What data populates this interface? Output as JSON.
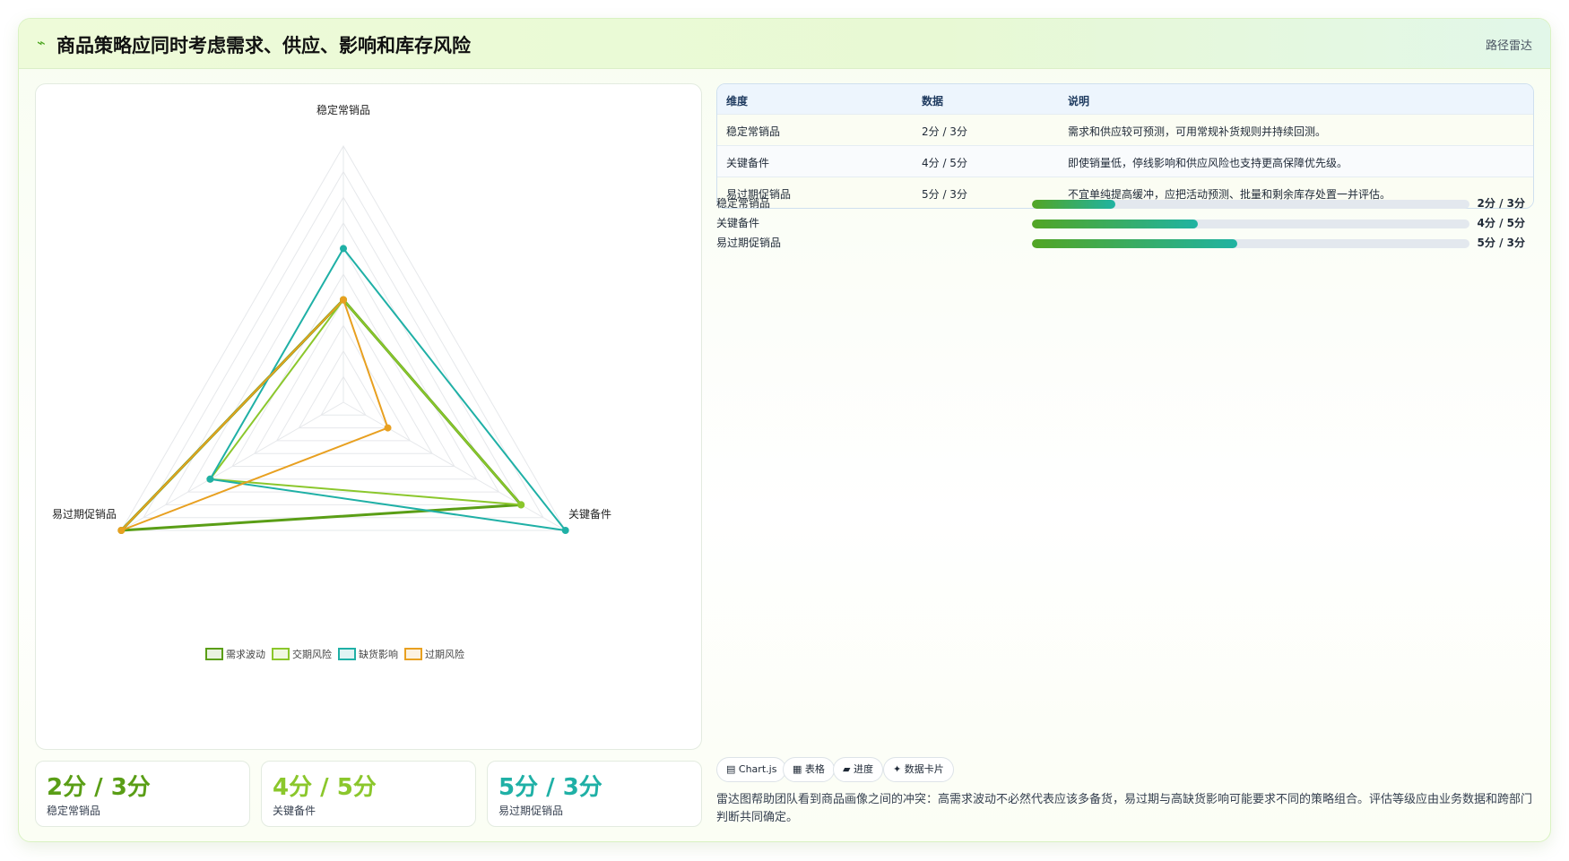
{
  "header": {
    "icon": "bolt-icon",
    "title": "商品策略应同时考虑需求、供应、影响和库存风险",
    "tag": "路径雷达"
  },
  "chart_data": {
    "type": "radar",
    "axes": [
      "稳定常销品",
      "关键备件",
      "易过期促销品"
    ],
    "max": 5,
    "series": [
      {
        "name": "需求波动",
        "values": [
          2,
          4,
          5
        ],
        "color": "#5a9e16"
      },
      {
        "name": "交期风险",
        "values": [
          2,
          4,
          3
        ],
        "color": "#8bc72c"
      },
      {
        "name": "缺货影响",
        "values": [
          3,
          5,
          3
        ],
        "color": "#1fb0a6"
      },
      {
        "name": "过期风险",
        "values": [
          2,
          1,
          5
        ],
        "color": "#e8a020"
      }
    ],
    "grid_levels": 10,
    "legend_position": "bottom"
  },
  "stats": [
    {
      "value": "2分 / 3分",
      "label": "稳定常销品",
      "color": "#5a9e16"
    },
    {
      "value": "4分 / 5分",
      "label": "关键备件",
      "color": "#8bc72c"
    },
    {
      "value": "5分 / 3分",
      "label": "易过期促销品",
      "color": "#1fb0a6"
    }
  ],
  "table": {
    "headers": [
      "维度",
      "数据",
      "说明"
    ],
    "rows": [
      [
        "稳定常销品",
        "2分 / 3分",
        "需求和供应较可预测，可用常规补货规则并持续回测。"
      ],
      [
        "关键备件",
        "4分 / 5分",
        "即使销量低，停线影响和供应风险也支持更高保障优先级。"
      ],
      [
        "易过期促销品",
        "5分 / 3分",
        "不宜单纯提高缓冲，应把活动预测、批量和剩余库存处置一并评估。"
      ]
    ]
  },
  "progress": [
    {
      "label": "稳定常销品",
      "value": "2分 / 3分",
      "fraction": 0.19
    },
    {
      "label": "关键备件",
      "value": "4分 / 5分",
      "fraction": 0.38
    },
    {
      "label": "易过期促销品",
      "value": "5分 / 3分",
      "fraction": 0.47
    }
  ],
  "chips": [
    {
      "icon": "chart-icon",
      "glyph": "▤",
      "label": "Chart.js"
    },
    {
      "icon": "table-icon",
      "glyph": "▦",
      "label": "表格"
    },
    {
      "icon": "progress-icon",
      "glyph": "▰",
      "label": "进度"
    },
    {
      "icon": "sparkle-icon",
      "glyph": "✦",
      "label": "数据卡片"
    }
  ],
  "note": "雷达图帮助团队看到商品画像之间的冲突：高需求波动不必然代表应该多备货，易过期与高缺货影响可能要求不同的策略组合。评估等级应由业务数据和跨部门判断共同确定。"
}
